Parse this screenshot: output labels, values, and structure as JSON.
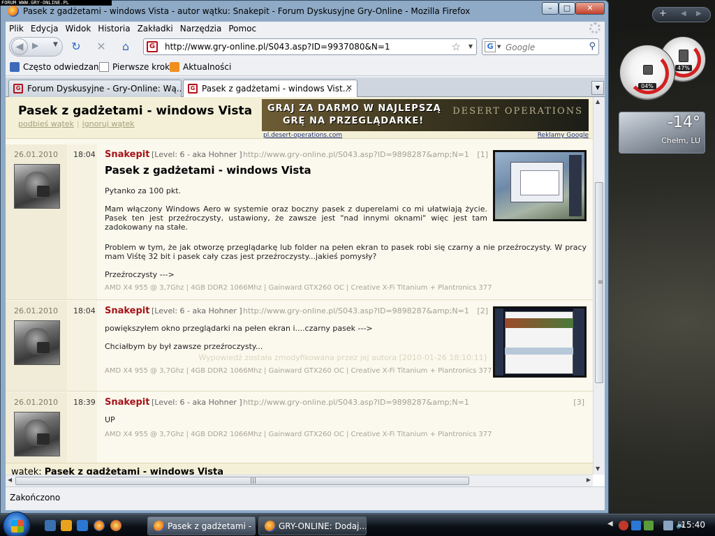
{
  "watermark": "FORUM WWW.GRY-ONLINE.PL",
  "window": {
    "title": "Pasek z gadżetami - windows Vista - autor wątku: Snakepit - Forum Dyskusyjne Gry-Online - Mozilla Firefox"
  },
  "menu": [
    "Plik",
    "Edycja",
    "Widok",
    "Historia",
    "Zakładki",
    "Narzędzia",
    "Pomoc"
  ],
  "navigation": {
    "url": "http://www.gry-online.pl/S043.asp?ID=9937080&N=1",
    "search_placeholder": "Google"
  },
  "bookmarks": [
    "Często odwiedzane",
    "Pierwsze kroki",
    "Aktualności"
  ],
  "tabs": [
    {
      "label": "Forum Dyskusyjne - Gry-Online: Wą...",
      "active": false
    },
    {
      "label": "Pasek z gadżetami - windows Vist...",
      "active": true
    }
  ],
  "page": {
    "title": "Pasek z gadżetami - windows Vista",
    "link_bump": "podbieś wątek",
    "link_ignore": "ignoruj wątek",
    "banner": {
      "line1": "GRAJ ZA DARMO W NAJLEPSZĄ",
      "line2": "GRĘ NA PRZEGLĄDARKE!",
      "logo": "DESERT OPERATIONS"
    },
    "ad_url": "pl.desert-operations.com",
    "ad_google": "Reklamy Google",
    "posts": [
      {
        "date": "26.01.2010",
        "time": "18:04",
        "author": "Snakepit",
        "level": "[Level: 6 - aka Hohner ]",
        "link": "http://www.gry-online.pl/S043.asp?ID=9898287&amp;N=1",
        "number": "[1]",
        "heading": "Pasek z gadżetami - windows Vista",
        "body": [
          "Pytanko za 100 pkt.",
          "Mam włączony Windows Aero w systemie oraz boczny pasek z duperelami co mi ułatwiają życie. Pasek ten jest przeźroczysty, ustawiony, że zawsze jest \"nad innymi oknami\" więc jest tam zadokowany na stałe.",
          "Problem w tym, że jak otworzę przeglądarkę lub folder na pełen ekran to pasek robi się czarny a nie przeźroczysty. W pracy mam Viśtę 32 bit i pasek cały czas jest przeźroczysty...jakieś pomysły?",
          "Przeźroczysty --->"
        ],
        "signature": "AMD X4 955 @ 3,7Ghz | 4GB DDR2 1066Mhz | Gainward GTX260 OC | Creative X-Fi Titanium + Plantronics 377"
      },
      {
        "date": "26.01.2010",
        "time": "18:04",
        "author": "Snakepit",
        "level": "[Level: 6 - aka Hohner ]",
        "link": "http://www.gry-online.pl/S043.asp?ID=9898287&amp;N=1",
        "number": "[2]",
        "body": [
          "powiększyłem okno przeglądarki na pełen ekran i....czarny pasek --->",
          "Chciałbym by był zawsze przeźroczysty..."
        ],
        "modified": "Wypowiedź została zmodyfikowana przez jej autora [2010-01-26 18:10:11]",
        "signature": "AMD X4 955 @ 3,7Ghz | 4GB DDR2 1066Mhz | Gainward GTX260 OC | Creative X-Fi Titanium + Plantronics 377"
      },
      {
        "date": "26.01.2010",
        "time": "18:39",
        "author": "Snakepit",
        "level": "[Level: 6 - aka Hohner ]",
        "link": "http://www.gry-online.pl/S043.asp?ID=9898287&amp;N=1",
        "number": "[3]",
        "body": [
          "UP"
        ],
        "signature": "AMD X4 955 @ 3,7Ghz | 4GB DDR2 1066Mhz | Gainward GTX260 OC | Creative X-Fi Titanium + Plantronics 377"
      }
    ],
    "footer_label": "wątek:",
    "footer_title": "Pasek z gadżetami - windows Vista"
  },
  "status": "Zakończono",
  "gadgets": {
    "cpu": "04%",
    "memory": "47%",
    "temperature": "-14°",
    "location": "Chełm, LU"
  },
  "taskbar": {
    "tasks": [
      {
        "label": "Pasek z gadżetami - ...",
        "active": true
      },
      {
        "label": "GRY-ONLINE: Dodaj...",
        "active": false
      }
    ],
    "clock": "15:40"
  }
}
